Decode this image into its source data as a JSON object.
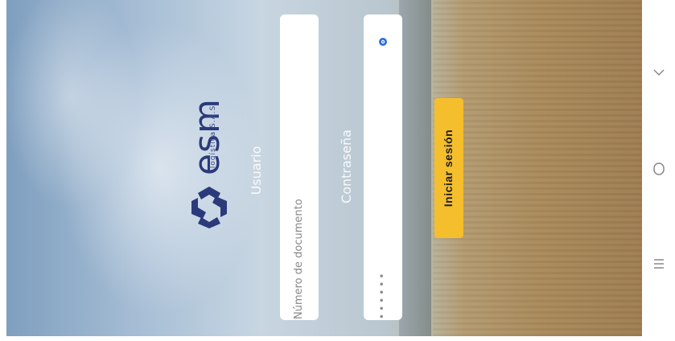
{
  "brand": {
    "name": "esm",
    "tagline": "logística S.A.S"
  },
  "login": {
    "user_label": "Usuario",
    "user_placeholder": "Número de documento",
    "password_label": "Contraseña",
    "password_value": "••••••",
    "submit_label": "Iniciar sesión",
    "accent_color": "#f5be2c",
    "brand_color": "#2b3a7a"
  },
  "system_nav": {
    "icons": [
      "chevron-down-icon",
      "home-circle-icon",
      "menu-lines-icon"
    ]
  }
}
